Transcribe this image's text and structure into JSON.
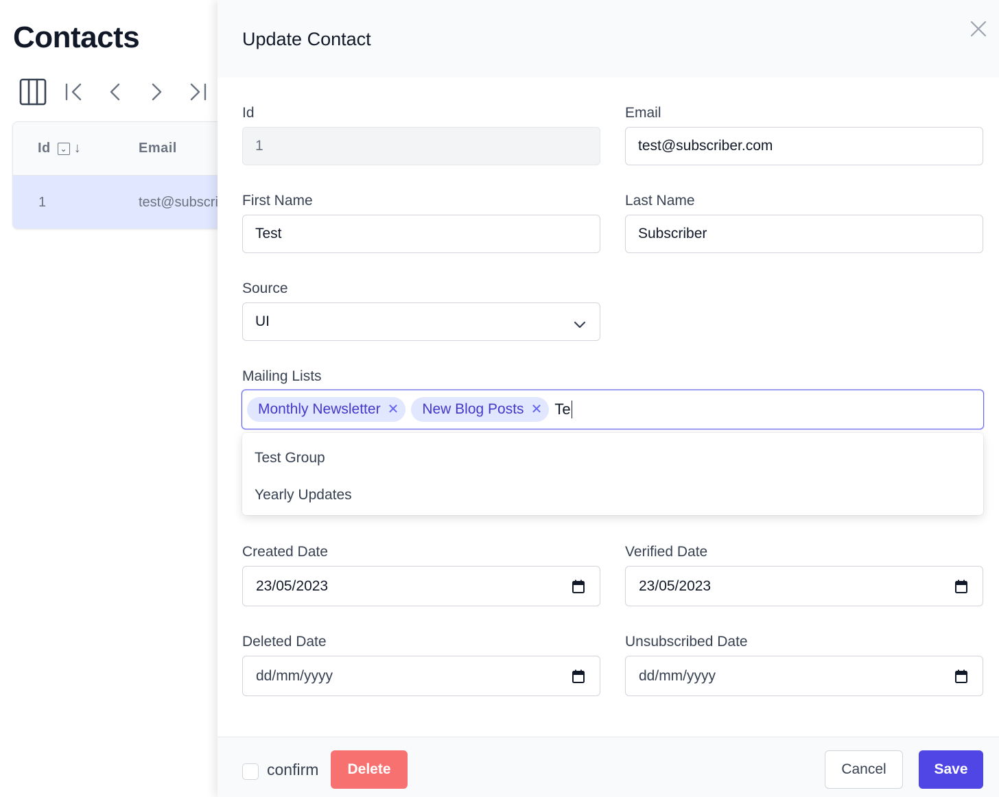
{
  "background": {
    "title": "Contacts",
    "table": {
      "columns": [
        "Id",
        "Email"
      ],
      "rows": [
        {
          "id": "1",
          "email": "test@subscri"
        }
      ]
    }
  },
  "drawer": {
    "title": "Update Contact",
    "fields": {
      "id": {
        "label": "Id",
        "value": "1"
      },
      "email": {
        "label": "Email",
        "value": "test@subscriber.com"
      },
      "first_name": {
        "label": "First Name",
        "value": "Test"
      },
      "last_name": {
        "label": "Last Name",
        "value": "Subscriber"
      },
      "source": {
        "label": "Source",
        "value": "UI"
      },
      "mailing_lists": {
        "label": "Mailing Lists",
        "chips": [
          "Monthly Newsletter",
          "New Blog Posts"
        ],
        "typed": "Te",
        "options": [
          "Test Group",
          "Yearly Updates"
        ]
      },
      "created_date": {
        "label": "Created Date",
        "value": "23/05/2023"
      },
      "verified_date": {
        "label": "Verified Date",
        "value": "23/05/2023"
      },
      "deleted_date": {
        "label": "Deleted Date",
        "value": "dd/mm/yyyy"
      },
      "unsubscribed_date": {
        "label": "Unsubscribed Date",
        "value": "dd/mm/yyyy"
      }
    },
    "footer": {
      "confirm_label": "confirm",
      "delete_label": "Delete",
      "cancel_label": "Cancel",
      "save_label": "Save"
    }
  },
  "colors": {
    "accent": "#4f46e5",
    "chip_bg": "#e0e7ff",
    "chip_text": "#4338ca",
    "danger": "#f87171",
    "selected_row": "#e0e7ff"
  },
  "icons": [
    "columns-icon",
    "first-page-icon",
    "prev-page-icon",
    "next-page-icon",
    "last-page-icon",
    "checkbox-filter-icon",
    "sort-down-icon",
    "close-icon",
    "chevron-down-icon",
    "calendar-icon",
    "chip-remove-icon"
  ]
}
